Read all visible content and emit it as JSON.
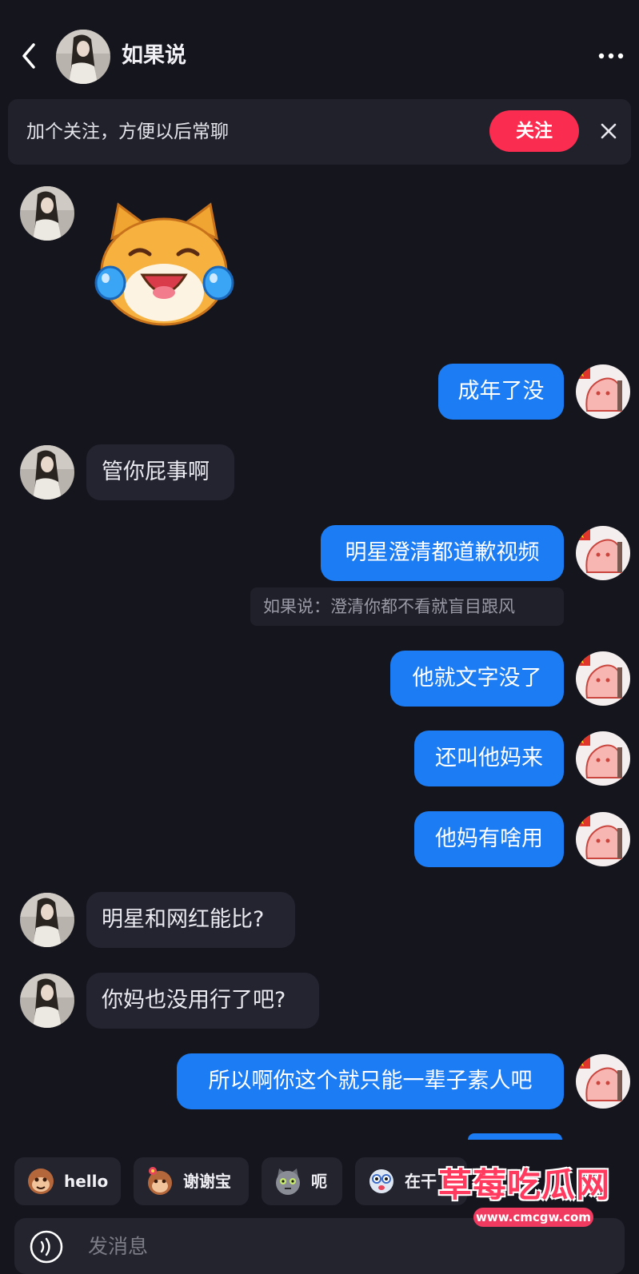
{
  "header": {
    "contact_name": "如果说",
    "back_icon": "chevron-left-icon",
    "more_icon": "more-dots-icon"
  },
  "follow_banner": {
    "text": "加个关注，方便以后常聊",
    "follow_label": "关注",
    "close_icon": "close-icon"
  },
  "messages": [
    {
      "side": "in",
      "type": "sticker",
      "sticker": "crying-laughing-cat"
    },
    {
      "side": "out",
      "text": "成年了没"
    },
    {
      "side": "in",
      "text": "管你屁事啊"
    },
    {
      "side": "out",
      "text": "明星澄清都道歉视频"
    },
    {
      "side": "in",
      "text": "他就文字没了"
    },
    {
      "side": "out",
      "text": "还叫他妈来"
    },
    {
      "side": "out",
      "text": "他妈有啥用"
    },
    {
      "side": "in",
      "text": "明星和网红能比?"
    },
    {
      "side": "in",
      "text": "你妈也没用行了吧?"
    },
    {
      "side": "out",
      "text": "所以啊你这个就只能一辈子素人吧"
    }
  ],
  "quote": {
    "text": "如果说：澄清你都不看就盲目跟风"
  },
  "quick_replies": [
    {
      "label": "hello",
      "icon": "monkey-icon"
    },
    {
      "label": "谢谢宝",
      "icon": "monkey-flower-icon"
    },
    {
      "label": "呃",
      "icon": "cat-icon"
    },
    {
      "label": "在干",
      "icon": "face-icon"
    }
  ],
  "input": {
    "placeholder": "发消息",
    "voice_icon": "voice-icon"
  },
  "watermark": {
    "title": "草莓吃瓜网",
    "url": "www.cmcgw.com"
  },
  "colors": {
    "background": "#15151e",
    "outgoing_bubble": "#1c7cf3",
    "incoming_bubble": "#232430",
    "follow_button": "#fa2c4f"
  }
}
